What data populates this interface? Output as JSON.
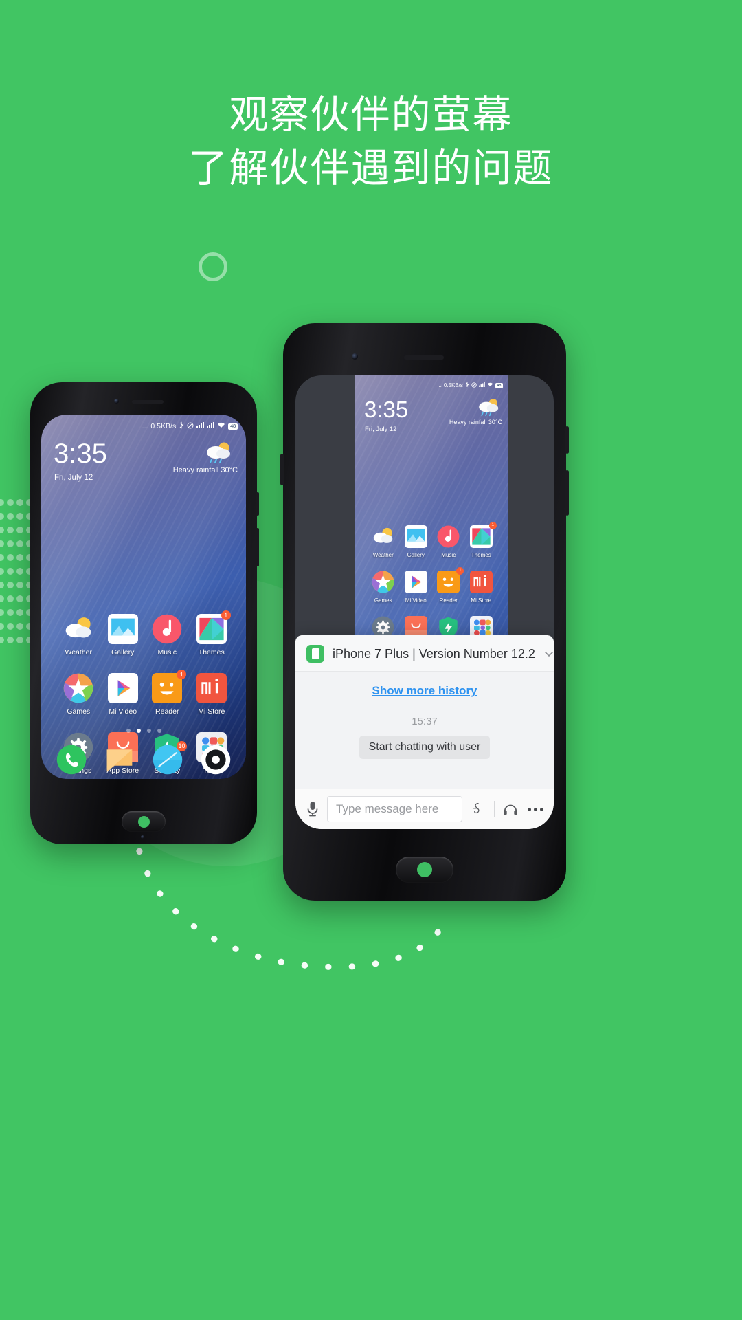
{
  "background_color": "#41c563",
  "headline": {
    "line1": "观察伙伴的萤幕",
    "line2": "了解伙伴遇到的问题"
  },
  "phone_screen": {
    "status_bar": {
      "network_speed": "0.5KB/s",
      "leading_dots": "...",
      "icons": [
        "bluetooth-icon",
        "mute-icon",
        "signal-icon",
        "signal-icon",
        "wifi-icon"
      ],
      "battery": "48"
    },
    "clock": "3:35",
    "date": "Fri, July 12",
    "weather_condition": "Heavy rainfall",
    "weather_temp": "30°C",
    "apps": [
      {
        "label": "Weather",
        "icon": "weather-icon",
        "badge": ""
      },
      {
        "label": "Gallery",
        "icon": "gallery-icon",
        "badge": ""
      },
      {
        "label": "Music",
        "icon": "music-icon",
        "badge": ""
      },
      {
        "label": "Themes",
        "icon": "themes-icon",
        "badge": "1"
      },
      {
        "label": "Games",
        "icon": "games-icon",
        "badge": ""
      },
      {
        "label": "Mi Video",
        "icon": "mi-video-icon",
        "badge": ""
      },
      {
        "label": "Reader",
        "icon": "reader-icon",
        "badge": "1"
      },
      {
        "label": "Mi Store",
        "icon": "mi-store-icon",
        "badge": ""
      },
      {
        "label": "Settings",
        "icon": "settings-icon",
        "badge": ""
      },
      {
        "label": "App Store",
        "icon": "app-store-icon",
        "badge": ""
      },
      {
        "label": "Security",
        "icon": "security-icon",
        "badge": ""
      },
      {
        "label": "Tools",
        "icon": "tools-folder-icon",
        "badge": ""
      }
    ],
    "page_dots": {
      "count": 4,
      "active_index": 1
    },
    "dock": [
      {
        "icon": "phone-icon",
        "badge": ""
      },
      {
        "icon": "messages-icon",
        "badge": ""
      },
      {
        "icon": "browser-icon",
        "badge": "10"
      },
      {
        "icon": "camera-icon",
        "badge": ""
      }
    ]
  },
  "chat_panel": {
    "device_title": "iPhone 7 Plus | Version Number 12.2",
    "device_icon": "phone-device-icon",
    "collapse_icon": "chevron-down-icon",
    "show_more_history": "Show more history",
    "timestamp": "15:37",
    "system_message": "Start chatting with user",
    "input": {
      "mic_icon": "microphone-icon",
      "placeholder": "Type message here",
      "value": "",
      "actions": [
        "emoji-sticker-icon",
        "headset-icon",
        "more-options-icon"
      ]
    }
  },
  "colors": {
    "brand_green": "#41c563",
    "link_blue": "#2f93f0",
    "badge_orange": "#fb5d33"
  }
}
